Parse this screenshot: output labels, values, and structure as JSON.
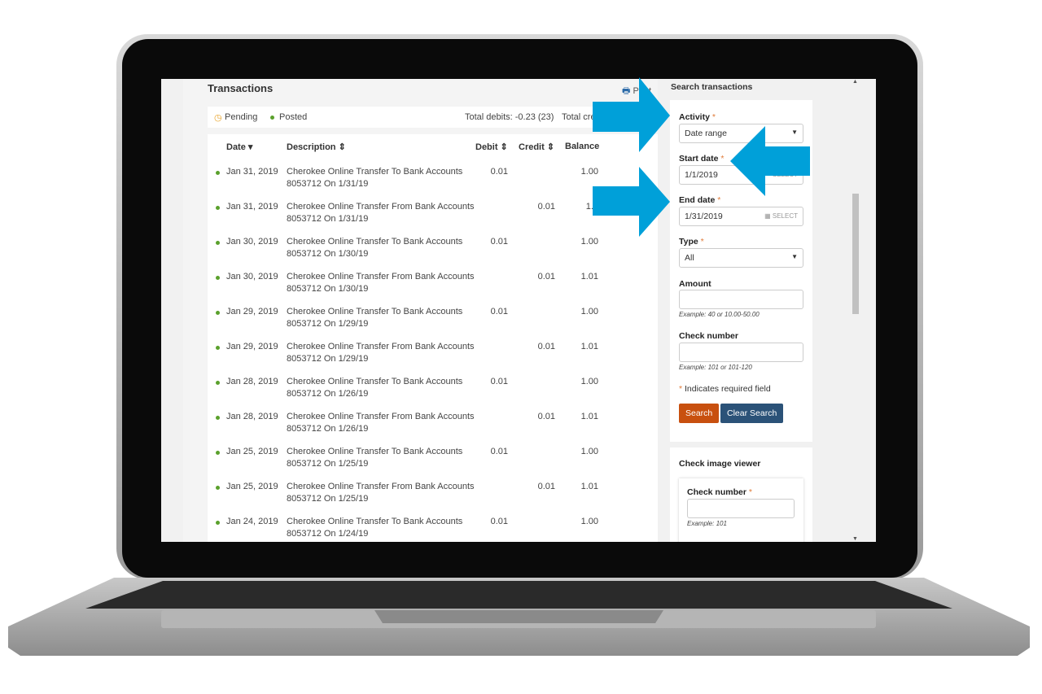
{
  "header": {
    "title": "Transactions",
    "print_label": "Print"
  },
  "legend": {
    "pending": "Pending",
    "posted": "Posted",
    "total_debits": "Total debits: -0.23 (23)",
    "total_credits": "Total cre"
  },
  "table": {
    "columns": [
      "Date",
      "Description",
      "Debit",
      "Credit",
      "Balance"
    ],
    "rows": [
      {
        "date": "Jan 31, 2019",
        "desc1": "Cherokee Online Transfer To Bank Accounts",
        "desc2": "8053712 On 1/31/19",
        "debit": "0.01",
        "credit": "",
        "balance": "1.00"
      },
      {
        "date": "Jan 31, 2019",
        "desc1": "Cherokee Online Transfer From Bank Accounts",
        "desc2": "8053712 On 1/31/19",
        "debit": "",
        "credit": "0.01",
        "balance": "1.0"
      },
      {
        "date": "Jan 30, 2019",
        "desc1": "Cherokee Online Transfer To Bank Accounts",
        "desc2": "8053712 On 1/30/19",
        "debit": "0.01",
        "credit": "",
        "balance": "1.00"
      },
      {
        "date": "Jan 30, 2019",
        "desc1": "Cherokee Online Transfer From Bank Accounts",
        "desc2": "8053712 On 1/30/19",
        "debit": "",
        "credit": "0.01",
        "balance": "1.01"
      },
      {
        "date": "Jan 29, 2019",
        "desc1": "Cherokee Online Transfer To Bank Accounts",
        "desc2": "8053712 On 1/29/19",
        "debit": "0.01",
        "credit": "",
        "balance": "1.00"
      },
      {
        "date": "Jan 29, 2019",
        "desc1": "Cherokee Online Transfer From Bank Accounts",
        "desc2": "8053712 On 1/29/19",
        "debit": "",
        "credit": "0.01",
        "balance": "1.01"
      },
      {
        "date": "Jan 28, 2019",
        "desc1": "Cherokee Online Transfer To Bank Accounts",
        "desc2": "8053712 On 1/26/19",
        "debit": "0.01",
        "credit": "",
        "balance": "1.00"
      },
      {
        "date": "Jan 28, 2019",
        "desc1": "Cherokee Online Transfer From Bank Accounts",
        "desc2": "8053712 On 1/26/19",
        "debit": "",
        "credit": "0.01",
        "balance": "1.01"
      },
      {
        "date": "Jan 25, 2019",
        "desc1": "Cherokee Online Transfer To Bank Accounts",
        "desc2": "8053712 On 1/25/19",
        "debit": "0.01",
        "credit": "",
        "balance": "1.00"
      },
      {
        "date": "Jan 25, 2019",
        "desc1": "Cherokee Online Transfer From Bank Accounts",
        "desc2": "8053712 On 1/25/19",
        "debit": "",
        "credit": "0.01",
        "balance": "1.01"
      },
      {
        "date": "Jan 24, 2019",
        "desc1": "Cherokee Online Transfer To Bank Accounts",
        "desc2": "8053712 On 1/24/19",
        "debit": "0.01",
        "credit": "",
        "balance": "1.00"
      }
    ]
  },
  "search": {
    "title": "Search transactions",
    "activity_label": "Activity",
    "activity_value": "Date range",
    "start_label": "Start date",
    "start_value": "1/1/2019",
    "end_label": "End date",
    "end_value": "1/31/2019",
    "select_label": "SELECT",
    "type_label": "Type",
    "type_value": "All",
    "amount_label": "Amount",
    "amount_hint": "Example: 40 or 10.00-50.00",
    "check_label": "Check number",
    "check_hint": "Example: 101 or 101-120",
    "required_note": "Indicates required field",
    "required_mark": "*",
    "search_btn": "Search",
    "clear_btn": "Clear Search"
  },
  "check_viewer": {
    "title": "Check image viewer",
    "check_label": "Check number",
    "hint": "Example: 101"
  },
  "colors": {
    "arrow": "#00a0d9",
    "search_btn": "#c8500f",
    "clear_btn": "#2b5278",
    "posted_dot": "#5aa02c",
    "pending": "#e8a020"
  }
}
